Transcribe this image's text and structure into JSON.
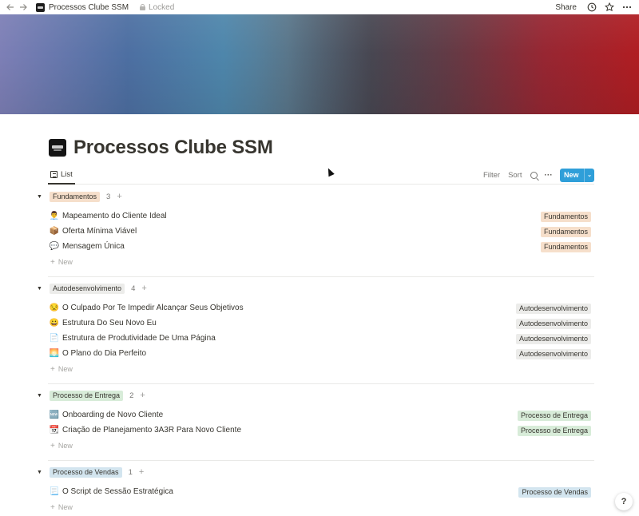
{
  "topbar": {
    "title": "Processos Clube SSM",
    "locked_label": "Locked",
    "share_label": "Share",
    "icons": [
      "back-arrow-icon",
      "forward-arrow-icon",
      "lock-icon",
      "history-clock-icon",
      "star-icon",
      "more-icon"
    ]
  },
  "page": {
    "title": "Processos Clube SSM"
  },
  "viewbar": {
    "tab_label": "List",
    "filter_label": "Filter",
    "sort_label": "Sort",
    "more_label": "···",
    "new_label": "New",
    "new_caret": "⌄"
  },
  "groups": [
    {
      "tag": "Fundamentos",
      "color": "#f6dfcb",
      "count": "3",
      "items": [
        {
          "emoji": "👨‍💼",
          "title": "Mapeamento do Cliente Ideal",
          "tag": "Fundamentos"
        },
        {
          "emoji": "📦",
          "title": "Oferta Mínima Viável",
          "tag": "Fundamentos"
        },
        {
          "emoji": "💬",
          "title": "Mensagem Única",
          "tag": "Fundamentos"
        }
      ]
    },
    {
      "tag": "Autodesenvolvimento",
      "color": "#ececea",
      "count": "4",
      "items": [
        {
          "emoji": "😒",
          "title": "O Culpado Por Te Impedir Alcançar Seus Objetivos",
          "tag": "Autodesenvolvimento"
        },
        {
          "emoji": "😀",
          "title": "Estrutura Do Seu Novo Eu",
          "tag": "Autodesenvolvimento"
        },
        {
          "emoji": "📄",
          "title": "Estrutura de Produtividade De Uma Página",
          "tag": "Autodesenvolvimento"
        },
        {
          "emoji": "🌅",
          "title": "O Plano do Dia Perfeito",
          "tag": "Autodesenvolvimento"
        }
      ]
    },
    {
      "tag": "Processo de Entrega",
      "color": "#d8ecd9",
      "count": "2",
      "items": [
        {
          "emoji": "🆕",
          "title": "Onboarding de Novo Cliente",
          "tag": "Processo de Entrega"
        },
        {
          "emoji": "📆",
          "title": "Criação de Planejamento 3A3R Para Novo Cliente",
          "tag": "Processo de Entrega"
        }
      ]
    },
    {
      "tag": "Processo de Vendas",
      "color": "#d3e5ef",
      "count": "1",
      "items": [
        {
          "emoji": "📃",
          "title": "O Script de Sessão Estratégica",
          "tag": "Processo de Vendas"
        }
      ]
    }
  ],
  "new_row_label": "New",
  "help_label": "?"
}
